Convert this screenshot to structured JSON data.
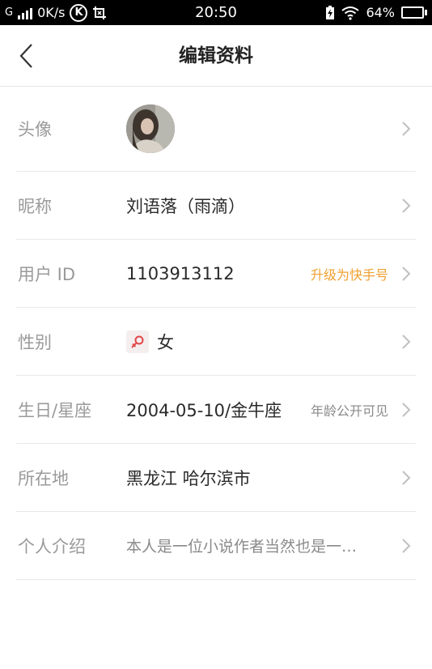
{
  "status_bar": {
    "network_type": "G",
    "speed": "0K/s",
    "k_badge": "K",
    "time": "20:50",
    "battery_percent": "64%",
    "battery_level": 0.64
  },
  "header": {
    "title": "编辑资料"
  },
  "rows": [
    {
      "label": "头像"
    },
    {
      "label": "昵称",
      "value": "刘语落（雨滴）"
    },
    {
      "label": "用户 ID",
      "value": "1103913112",
      "extra": "升级为快手号"
    },
    {
      "label": "性别",
      "value": "女"
    },
    {
      "label": "生日/星座",
      "value": "2004-05-10/金牛座",
      "extra": "年龄公开可见"
    },
    {
      "label": "所在地",
      "value": "黑龙江 哈尔滨市"
    },
    {
      "label": "个人介绍",
      "value": "本人是一位小说作者当然也是一…"
    }
  ],
  "colors": {
    "accent_orange": "#f0a030",
    "label_gray": "#9a9a9a",
    "divider": "#e8e8e8"
  }
}
